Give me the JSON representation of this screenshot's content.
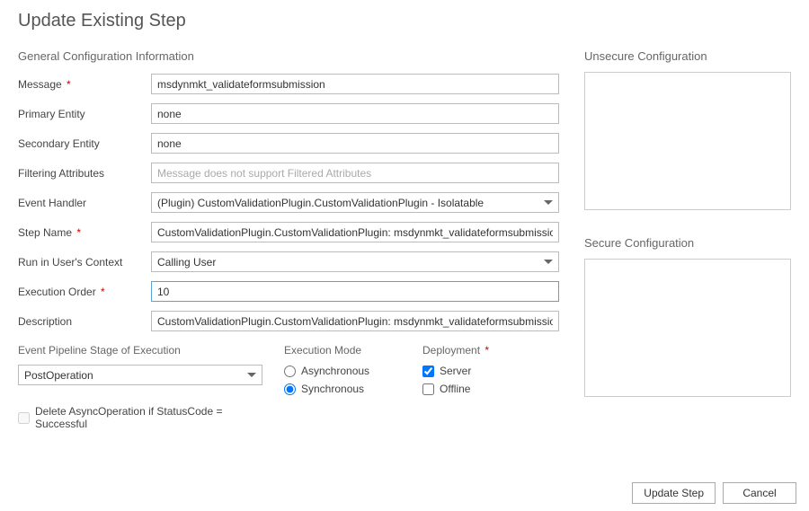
{
  "title": "Update Existing Step",
  "sections": {
    "general": "General Configuration Information",
    "pipeline": "Event Pipeline Stage of Execution",
    "execMode": "Execution Mode",
    "deployment": "Deployment",
    "unsecure": "Unsecure  Configuration",
    "secure": "Secure  Configuration"
  },
  "labels": {
    "message": "Message",
    "primaryEntity": "Primary Entity",
    "secondaryEntity": "Secondary Entity",
    "filteringAttributes": "Filtering Attributes",
    "eventHandler": "Event Handler",
    "stepName": "Step Name",
    "runInContext": "Run in User's Context",
    "executionOrder": "Execution Order",
    "description": "Description",
    "deleteAsync": "Delete AsyncOperation if StatusCode = Successful",
    "asynchronous": "Asynchronous",
    "synchronous": "Synchronous",
    "server": "Server",
    "offline": "Offline"
  },
  "values": {
    "message": "msdynmkt_validateformsubmission",
    "primaryEntity": "none",
    "secondaryEntity": "none",
    "filteringPlaceholder": "Message does not support Filtered Attributes",
    "eventHandler": "(Plugin) CustomValidationPlugin.CustomValidationPlugin - Isolatable",
    "stepName": "CustomValidationPlugin.CustomValidationPlugin: msdynmkt_validateformsubmission of any Ent",
    "runInContext": "Calling User",
    "executionOrder": "10",
    "description": "CustomValidationPlugin.CustomValidationPlugin: msdynmkt_validateformsubmission of any Ent",
    "pipelineStage": "PostOperation",
    "execModeSelected": "synchronous",
    "serverChecked": true,
    "offlineChecked": false,
    "deleteAsyncChecked": false,
    "unsecureConfig": "",
    "secureConfig": ""
  },
  "buttons": {
    "update": "Update Step",
    "cancel": "Cancel"
  }
}
